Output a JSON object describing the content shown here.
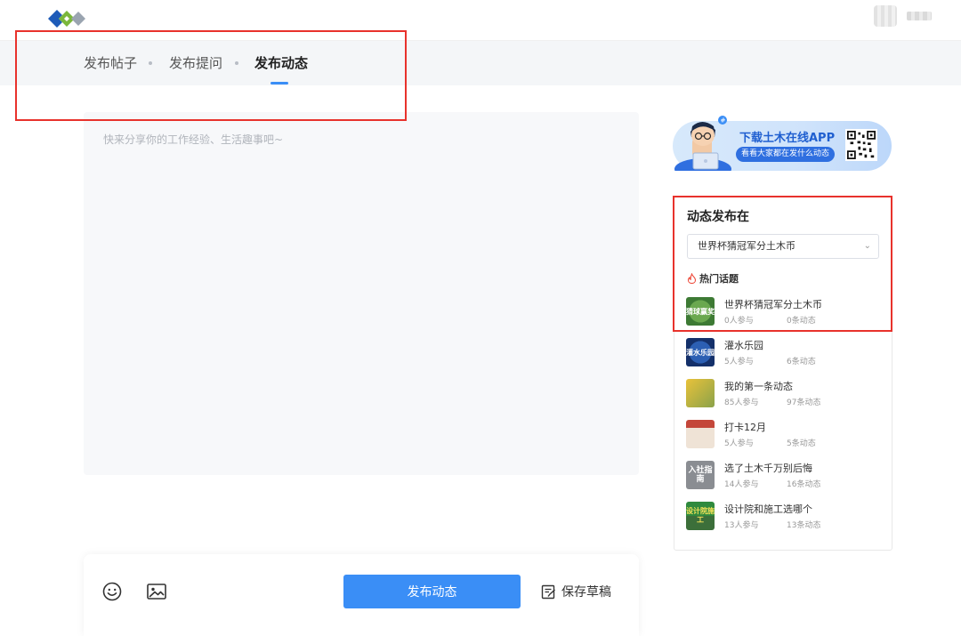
{
  "tabs": [
    {
      "label": "发布帖子",
      "active": false
    },
    {
      "label": "发布提问",
      "active": false
    },
    {
      "label": "发布动态",
      "active": true
    }
  ],
  "editor": {
    "placeholder": "快来分享你的工作经验、生活趣事吧~"
  },
  "toolbar": {
    "emoji_icon": "smiley-icon",
    "image_icon": "image-icon",
    "publish_label": "发布动态",
    "draft_label": "保存草稿",
    "draft_icon": "draft-icon"
  },
  "promo": {
    "title": "下载土木在线APP",
    "subtitle": "看看大家都在发什么动态"
  },
  "sidebar": {
    "title": "动态发布在",
    "selected_topic": "世界杯猜冠军分土木币",
    "hot_label": "热门话题",
    "hot_icon": "fire-icon",
    "topics": [
      {
        "name": "世界杯猜冠军分土木币",
        "participants": "0人参与",
        "posts": "0条动态",
        "thumb_text": "猜球赢奖"
      },
      {
        "name": "灌水乐园",
        "participants": "5人参与",
        "posts": "6条动态",
        "thumb_text": "灌水乐园"
      },
      {
        "name": "我的第一条动态",
        "participants": "85人参与",
        "posts": "97条动态",
        "thumb_text": ""
      },
      {
        "name": "打卡12月",
        "participants": "5人参与",
        "posts": "5条动态",
        "thumb_text": ""
      },
      {
        "name": "选了土木千万别后悔",
        "participants": "14人参与",
        "posts": "16条动态",
        "thumb_text": "入社指南"
      },
      {
        "name": "设计院和施工选哪个",
        "participants": "13人参与",
        "posts": "13条动态",
        "thumb_text": "设计院施工"
      }
    ]
  },
  "colors": {
    "accent": "#3a8ef6",
    "highlight_box": "#e8322c"
  }
}
